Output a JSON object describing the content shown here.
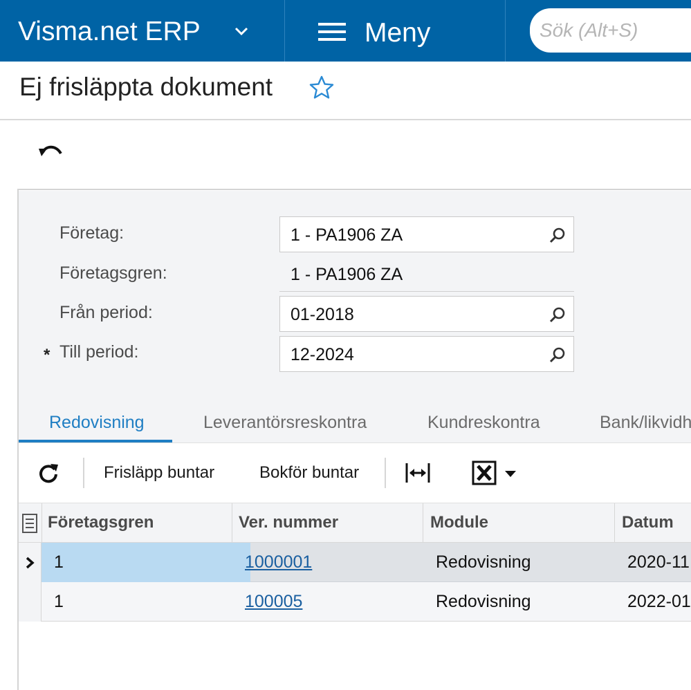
{
  "header": {
    "brand": "Visma.net ERP",
    "menu_label": "Meny",
    "search_placeholder": "Sök (Alt+S)"
  },
  "page": {
    "title": "Ej frisläppta dokument"
  },
  "form": {
    "company_label": "Företag:",
    "company_value": "1 - PA1906 ZA",
    "branch_label": "Företagsgren:",
    "branch_value": "1 - PA1906 ZA",
    "from_period_label": "Från period:",
    "from_period_value": "01-2018",
    "to_period_label": "Till period:",
    "to_period_value": "12-2024",
    "required_mark": "*"
  },
  "tabs": [
    {
      "label": "Redovisning",
      "active": true
    },
    {
      "label": "Leverantörsreskontra",
      "active": false
    },
    {
      "label": "Kundreskontra",
      "active": false
    },
    {
      "label": "Bank/likvidh",
      "active": false
    }
  ],
  "toolbar": {
    "release_label": "Frisläpp buntar",
    "post_label": "Bokför buntar"
  },
  "grid": {
    "columns": [
      "Företagsgren",
      "Ver. nummer",
      "Module",
      "Datum"
    ],
    "rows": [
      {
        "branch": "1",
        "number": "1000001",
        "module": "Redovisning",
        "date": "2020-11"
      },
      {
        "branch": "1",
        "number": "100005",
        "module": "Redovisning",
        "date": "2022-01"
      }
    ]
  },
  "colors": {
    "topbar": "#0063a5",
    "accent": "#1f7ec3",
    "selected_cell": "#b9daf2"
  }
}
